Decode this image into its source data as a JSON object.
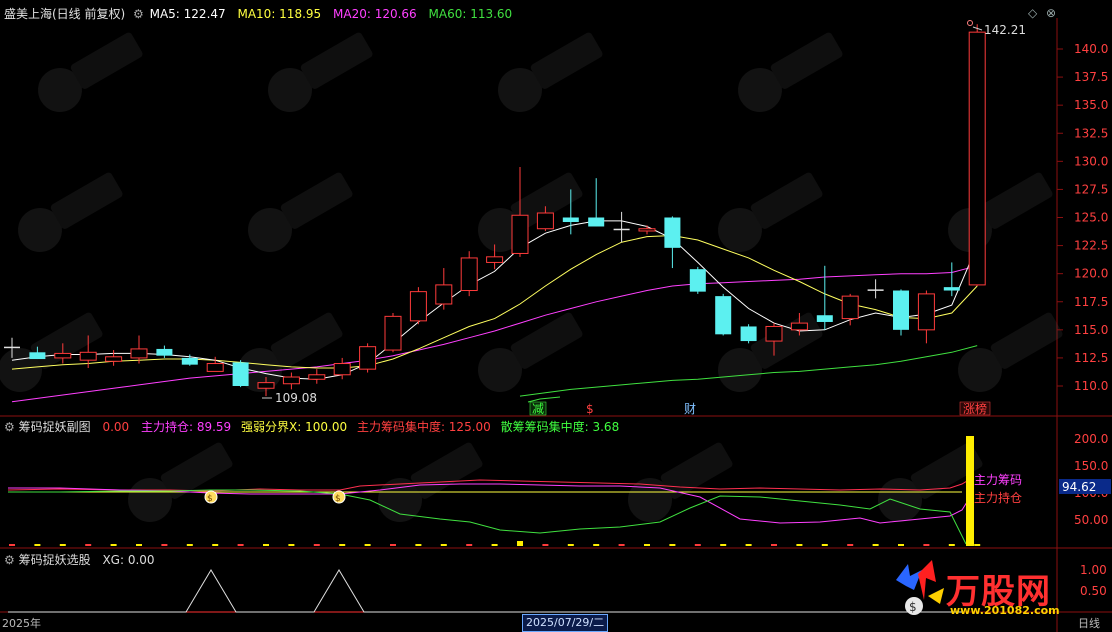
{
  "header": {
    "title": "盛美上海(日线 前复权)",
    "ma": [
      {
        "label": "MA5: 122.47",
        "color": "#ffffff"
      },
      {
        "label": "MA10: 118.95",
        "color": "#ffff40"
      },
      {
        "label": "MA20: 120.66",
        "color": "#ff40ff"
      },
      {
        "label": "MA60: 113.60",
        "color": "#40e040"
      }
    ]
  },
  "window_buttons": {
    "restore": "◇",
    "close": "⊗"
  },
  "main_chart": {
    "price_axis": [
      "140.0",
      "137.5",
      "135.0",
      "132.5",
      "130.0",
      "127.5",
      "125.0",
      "122.5",
      "120.0",
      "117.5",
      "115.0",
      "112.5",
      "110.0"
    ],
    "high_marker": "142.21",
    "low_marker": "109.08",
    "events": [
      {
        "label": "减",
        "color": "#40ff40"
      },
      {
        "label": "$",
        "color": "#ff4040"
      },
      {
        "label": "财",
        "color": "#80c0ff"
      },
      {
        "label": "涨榜",
        "color": "#ff4040"
      }
    ]
  },
  "sub1": {
    "title": "筹码捉妖副图",
    "items": [
      {
        "label": "0.00",
        "color": "#ff4040"
      },
      {
        "label": "主力持仓: 89.59",
        "color": "#ff40ff"
      },
      {
        "label": "强弱分界X: 100.00",
        "color": "#ffff40"
      },
      {
        "label": "主力筹码集中度: 125.00",
        "color": "#ff4040"
      },
      {
        "label": "散筹筹码集中度: 3.68",
        "color": "#40ff40"
      }
    ],
    "axis": [
      "200.0",
      "150.0",
      "100.0",
      "50.00"
    ],
    "value_box": "94.62",
    "annot_top": "主力筹码",
    "annot_bottom": "主力持仓"
  },
  "sub2": {
    "title": "筹码捉妖选股",
    "xg": "XG: 0.00",
    "axis": [
      "1.00",
      "0.50"
    ]
  },
  "footer": {
    "year": "2025年",
    "date": "2025/07/29/二",
    "period": "日线"
  },
  "brand": {
    "name": "万股网",
    "url": "www.201082.com"
  },
  "chart_data": {
    "type": "candlestick",
    "ylim": [
      108,
      142
    ],
    "candles": [
      {
        "o": 113.5,
        "h": 114.3,
        "l": 112.5,
        "c": 113.4,
        "d": "flat"
      },
      {
        "o": 113.0,
        "h": 113.5,
        "l": 112.4,
        "c": 112.4,
        "d": "down"
      },
      {
        "o": 112.5,
        "h": 113.8,
        "l": 112.0,
        "c": 112.9,
        "d": "up"
      },
      {
        "o": 112.3,
        "h": 114.5,
        "l": 111.6,
        "c": 113.0,
        "d": "up"
      },
      {
        "o": 112.2,
        "h": 113.2,
        "l": 111.8,
        "c": 112.6,
        "d": "up"
      },
      {
        "o": 112.5,
        "h": 114.5,
        "l": 112.0,
        "c": 113.3,
        "d": "up"
      },
      {
        "o": 113.3,
        "h": 113.6,
        "l": 112.5,
        "c": 112.7,
        "d": "down"
      },
      {
        "o": 112.5,
        "h": 112.8,
        "l": 111.8,
        "c": 111.9,
        "d": "down"
      },
      {
        "o": 112.0,
        "h": 112.6,
        "l": 111.5,
        "c": 111.3,
        "d": "up"
      },
      {
        "o": 112.1,
        "h": 112.3,
        "l": 109.9,
        "c": 110.0,
        "d": "down"
      },
      {
        "o": 109.8,
        "h": 110.8,
        "l": 109.1,
        "c": 110.3,
        "d": "up"
      },
      {
        "o": 110.2,
        "h": 111.2,
        "l": 109.7,
        "c": 110.8,
        "d": "up"
      },
      {
        "o": 110.6,
        "h": 111.5,
        "l": 110.2,
        "c": 111.0,
        "d": "up"
      },
      {
        "o": 111.0,
        "h": 112.5,
        "l": 110.6,
        "c": 112.0,
        "d": "up"
      },
      {
        "o": 111.5,
        "h": 113.8,
        "l": 111.2,
        "c": 113.5,
        "d": "up"
      },
      {
        "o": 113.2,
        "h": 116.5,
        "l": 113.0,
        "c": 116.2,
        "d": "up"
      },
      {
        "o": 115.8,
        "h": 118.8,
        "l": 115.5,
        "c": 118.4,
        "d": "up"
      },
      {
        "o": 117.3,
        "h": 120.5,
        "l": 116.8,
        "c": 119.0,
        "d": "up"
      },
      {
        "o": 118.5,
        "h": 122.0,
        "l": 118.0,
        "c": 121.4,
        "d": "up"
      },
      {
        "o": 121.0,
        "h": 122.6,
        "l": 120.4,
        "c": 121.5,
        "d": "up"
      },
      {
        "o": 121.8,
        "h": 129.5,
        "l": 121.5,
        "c": 125.2,
        "d": "up"
      },
      {
        "o": 124.0,
        "h": 126.0,
        "l": 123.8,
        "c": 125.4,
        "d": "up"
      },
      {
        "o": 125.0,
        "h": 127.5,
        "l": 123.5,
        "c": 124.6,
        "d": "down"
      },
      {
        "o": 125.0,
        "h": 128.5,
        "l": 124.2,
        "c": 124.2,
        "d": "down"
      },
      {
        "o": 124.0,
        "h": 125.5,
        "l": 122.8,
        "c": 124.0,
        "d": "flat"
      },
      {
        "o": 124.0,
        "h": 124.3,
        "l": 123.5,
        "c": 123.8,
        "d": "up"
      },
      {
        "o": 125.0,
        "h": 125.1,
        "l": 120.5,
        "c": 122.3,
        "d": "down"
      },
      {
        "o": 120.4,
        "h": 120.6,
        "l": 118.2,
        "c": 118.4,
        "d": "down"
      },
      {
        "o": 118.0,
        "h": 118.2,
        "l": 114.5,
        "c": 114.6,
        "d": "down"
      },
      {
        "o": 115.3,
        "h": 115.5,
        "l": 113.8,
        "c": 114.0,
        "d": "down"
      },
      {
        "o": 114.0,
        "h": 115.6,
        "l": 112.7,
        "c": 115.3,
        "d": "up"
      },
      {
        "o": 115.0,
        "h": 116.5,
        "l": 114.5,
        "c": 115.6,
        "d": "up"
      },
      {
        "o": 116.3,
        "h": 120.7,
        "l": 115.0,
        "c": 115.7,
        "d": "down"
      },
      {
        "o": 116.0,
        "h": 118.2,
        "l": 115.4,
        "c": 118.0,
        "d": "up"
      },
      {
        "o": 118.5,
        "h": 119.5,
        "l": 117.8,
        "c": 118.6,
        "d": "flat"
      },
      {
        "o": 118.5,
        "h": 118.6,
        "l": 114.5,
        "c": 115.0,
        "d": "down"
      },
      {
        "o": 115.0,
        "h": 118.5,
        "l": 113.8,
        "c": 118.2,
        "d": "up"
      },
      {
        "o": 118.5,
        "h": 121.0,
        "l": 118.0,
        "c": 118.8,
        "d": "down"
      },
      {
        "o": 119.0,
        "h": 142.2,
        "l": 118.9,
        "c": 141.5,
        "d": "up"
      }
    ],
    "ma5": [
      112.3,
      112.6,
      112.8,
      112.8,
      112.9,
      112.9,
      112.8,
      112.6,
      112.3,
      111.6,
      111.1,
      110.7,
      110.6,
      111.0,
      112.0,
      113.8,
      115.7,
      117.4,
      119.0,
      120.2,
      122.3,
      123.6,
      124.3,
      124.7,
      124.7,
      124.2,
      123.1,
      121.0,
      118.8,
      116.9,
      115.6,
      114.9,
      115.0,
      115.9,
      116.5,
      116.1,
      116.4,
      117.2,
      122.5
    ],
    "ma10": [
      111.5,
      111.7,
      111.9,
      112.0,
      112.2,
      112.3,
      112.4,
      112.4,
      112.3,
      112.1,
      111.9,
      111.7,
      111.6,
      111.6,
      111.8,
      112.4,
      113.3,
      114.3,
      115.3,
      116.0,
      117.3,
      118.9,
      120.4,
      121.7,
      122.8,
      123.3,
      123.4,
      123.0,
      122.2,
      121.4,
      120.3,
      119.3,
      118.2,
      117.3,
      116.8,
      116.1,
      116.0,
      116.5,
      118.9
    ],
    "ma20": [
      108.6,
      108.9,
      109.2,
      109.5,
      109.8,
      110.1,
      110.4,
      110.7,
      110.9,
      111.1,
      111.3,
      111.5,
      111.7,
      112.0,
      112.3,
      112.7,
      113.2,
      113.7,
      114.3,
      114.9,
      115.6,
      116.3,
      116.9,
      117.5,
      118.0,
      118.5,
      118.9,
      119.1,
      119.2,
      119.3,
      119.4,
      119.5,
      119.7,
      119.8,
      119.9,
      120.0,
      120.0,
      120.1,
      120.7
    ],
    "ma60": [
      null,
      null,
      null,
      null,
      null,
      null,
      null,
      null,
      null,
      null,
      null,
      null,
      null,
      null,
      null,
      null,
      null,
      null,
      null,
      null,
      109.1,
      109.4,
      109.7,
      109.9,
      110.1,
      110.3,
      110.5,
      110.6,
      110.8,
      111.0,
      111.2,
      111.3,
      111.5,
      111.7,
      111.9,
      112.2,
      112.6,
      113.0,
      113.6
    ]
  }
}
